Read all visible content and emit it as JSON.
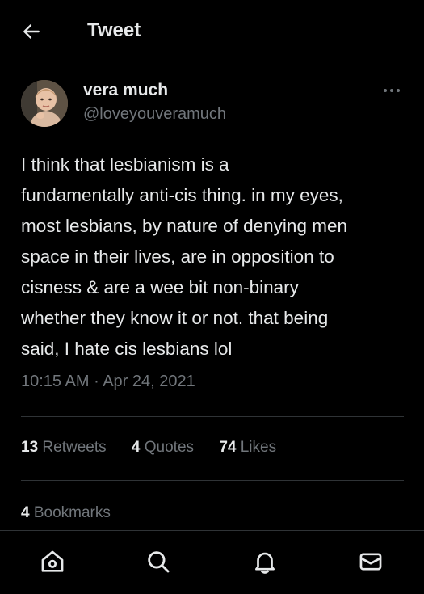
{
  "header": {
    "title": "Tweet"
  },
  "tweet": {
    "author": {
      "display_name": "vera much",
      "handle": "@loveyouveramuch"
    },
    "text_lines": [
      "I think that lesbianism is a",
      "fundamentally anti-cis thing. in my eyes,",
      "most lesbians, by nature of denying men",
      "space in their lives, are in opposition to",
      "cisness & are a wee bit non-binary",
      "whether they know it or not. that being",
      "said, I hate cis lesbians lol"
    ],
    "time": "10:15 AM",
    "separator": " · ",
    "date": "Apr 24, 2021"
  },
  "stats": {
    "retweets": {
      "count": "13",
      "label": "Retweets"
    },
    "quotes": {
      "count": "4",
      "label": "Quotes"
    },
    "likes": {
      "count": "74",
      "label": "Likes"
    }
  },
  "bookmarks": {
    "count": "4",
    "label": "Bookmarks"
  },
  "nav": {
    "items": [
      {
        "icon": "home-icon"
      },
      {
        "icon": "search-icon"
      },
      {
        "icon": "notifications-bell-icon"
      },
      {
        "icon": "messages-mail-icon"
      }
    ]
  },
  "colors": {
    "background": "#000000",
    "primary_text": "#e7e9ea",
    "secondary_text": "#71767b",
    "divider": "#2f3336"
  }
}
